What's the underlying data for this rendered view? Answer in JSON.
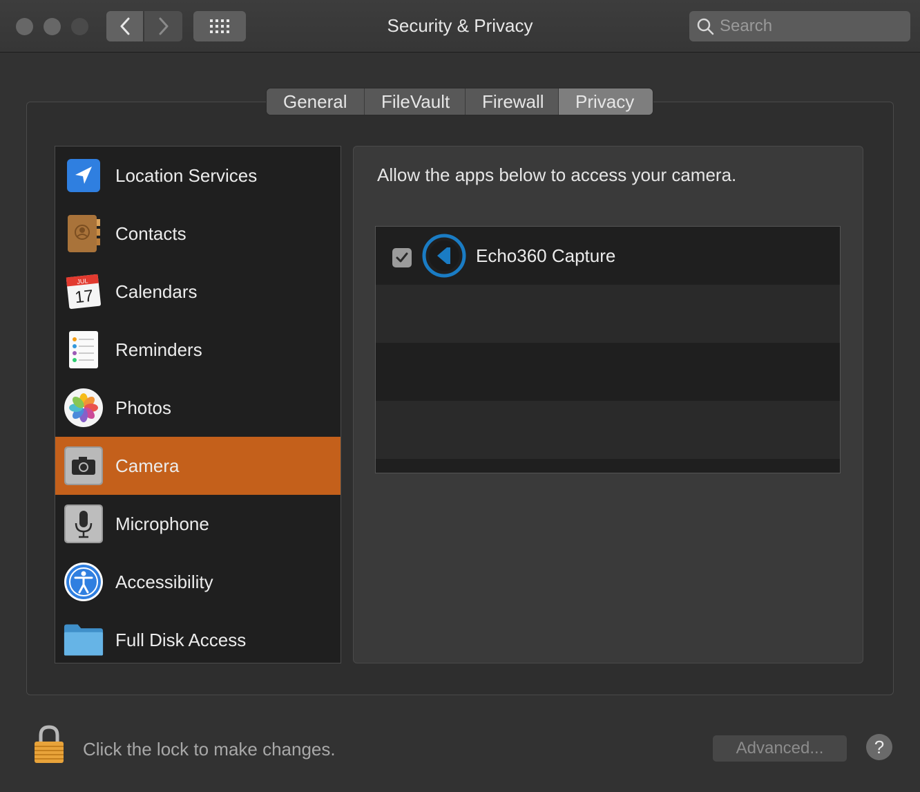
{
  "window": {
    "title": "Security & Privacy"
  },
  "search": {
    "placeholder": "Search"
  },
  "tabs": [
    {
      "label": "General"
    },
    {
      "label": "FileVault"
    },
    {
      "label": "Firewall"
    },
    {
      "label": "Privacy",
      "selected": true
    }
  ],
  "sidebar": {
    "items": [
      {
        "label": "Location Services",
        "icon": "location-arrow-icon"
      },
      {
        "label": "Contacts",
        "icon": "contacts-book-icon"
      },
      {
        "label": "Calendars",
        "icon": "calendar-icon",
        "month": "JUL",
        "day": "17"
      },
      {
        "label": "Reminders",
        "icon": "reminders-icon"
      },
      {
        "label": "Photos",
        "icon": "photos-flower-icon"
      },
      {
        "label": "Camera",
        "icon": "camera-icon",
        "selected": true
      },
      {
        "label": "Microphone",
        "icon": "microphone-icon"
      },
      {
        "label": "Accessibility",
        "icon": "accessibility-icon"
      },
      {
        "label": "Full Disk Access",
        "icon": "folder-icon"
      }
    ]
  },
  "main": {
    "description": "Allow the apps below to access your camera.",
    "apps": [
      {
        "name": "Echo360 Capture",
        "checked": true,
        "icon": "echo360-icon"
      }
    ]
  },
  "footer": {
    "lock_text": "Click the lock to make changes.",
    "advanced_label": "Advanced...",
    "help_label": "?"
  },
  "colors": {
    "accent": "#c4601b",
    "window_bg": "#323232"
  }
}
